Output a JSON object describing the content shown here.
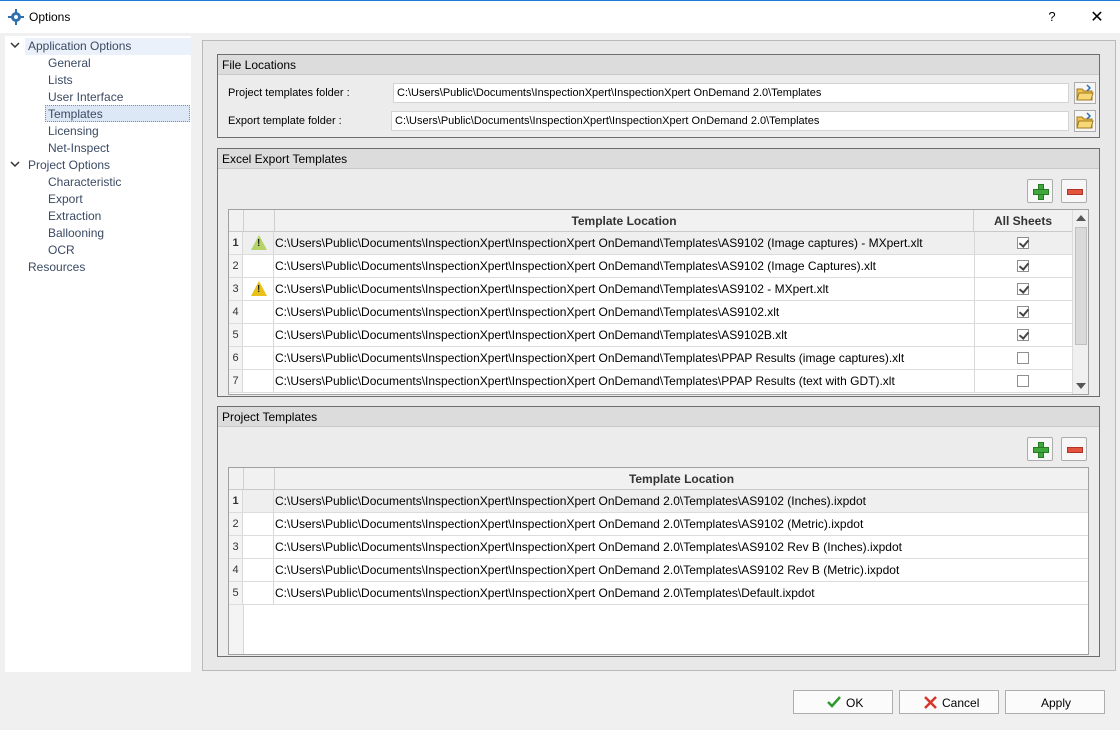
{
  "window": {
    "title": "Options",
    "help_label": "?",
    "close_label": "✕"
  },
  "nav": {
    "application_options": "Application Options",
    "general": "General",
    "lists": "Lists",
    "user_interface": "User Interface",
    "templates": "Templates",
    "licensing": "Licensing",
    "net_inspect": "Net-Inspect",
    "project_options": "Project Options",
    "characteristic": "Characteristic",
    "export": "Export",
    "extraction": "Extraction",
    "ballooning": "Ballooning",
    "ocr": "OCR",
    "resources": "Resources"
  },
  "file_locations": {
    "header": "File Locations",
    "project_label": "Project templates folder :",
    "project_value": "C:\\Users\\Public\\Documents\\InspectionXpert\\InspectionXpert OnDemand 2.0\\Templates",
    "export_label": "Export template folder :",
    "export_value": "C:\\Users\\Public\\Documents\\InspectionXpert\\InspectionXpert OnDemand 2.0\\Templates"
  },
  "excel_templates": {
    "header": "Excel Export Templates",
    "col_location": "Template Location",
    "col_sheets": "All Sheets",
    "rows": [
      {
        "num": "1",
        "location": "C:\\Users\\Public\\Documents\\InspectionXpert\\InspectionXpert OnDemand\\Templates\\AS9102 (Image captures) - MXpert.xlt",
        "all_sheets": true
      },
      {
        "num": "2",
        "location": "C:\\Users\\Public\\Documents\\InspectionXpert\\InspectionXpert OnDemand\\Templates\\AS9102 (Image Captures).xlt",
        "all_sheets": true
      },
      {
        "num": "3",
        "location": "C:\\Users\\Public\\Documents\\InspectionXpert\\InspectionXpert OnDemand\\Templates\\AS9102 - MXpert.xlt",
        "all_sheets": true
      },
      {
        "num": "4",
        "location": "C:\\Users\\Public\\Documents\\InspectionXpert\\InspectionXpert OnDemand\\Templates\\AS9102.xlt",
        "all_sheets": true
      },
      {
        "num": "5",
        "location": "C:\\Users\\Public\\Documents\\InspectionXpert\\InspectionXpert OnDemand\\Templates\\AS9102B.xlt",
        "all_sheets": true
      },
      {
        "num": "6",
        "location": "C:\\Users\\Public\\Documents\\InspectionXpert\\InspectionXpert OnDemand\\Templates\\PPAP Results (image captures).xlt",
        "all_sheets": false
      },
      {
        "num": "7",
        "location": "C:\\Users\\Public\\Documents\\InspectionXpert\\InspectionXpert OnDemand\\Templates\\PPAP Results (text with GDT).xlt",
        "all_sheets": false
      }
    ]
  },
  "project_templates": {
    "header": "Project Templates",
    "col_location": "Template Location",
    "rows": [
      {
        "num": "1",
        "location": "C:\\Users\\Public\\Documents\\InspectionXpert\\InspectionXpert OnDemand 2.0\\Templates\\AS9102 (Inches).ixpdot"
      },
      {
        "num": "2",
        "location": "C:\\Users\\Public\\Documents\\InspectionXpert\\InspectionXpert OnDemand 2.0\\Templates\\AS9102 (Metric).ixpdot"
      },
      {
        "num": "3",
        "location": "C:\\Users\\Public\\Documents\\InspectionXpert\\InspectionXpert OnDemand 2.0\\Templates\\AS9102 Rev B (Inches).ixpdot"
      },
      {
        "num": "4",
        "location": "C:\\Users\\Public\\Documents\\InspectionXpert\\InspectionXpert OnDemand 2.0\\Templates\\AS9102 Rev B (Metric).ixpdot"
      },
      {
        "num": "5",
        "location": "C:\\Users\\Public\\Documents\\InspectionXpert\\InspectionXpert OnDemand 2.0\\Templates\\Default.ixpdot"
      }
    ]
  },
  "buttons": {
    "ok": "OK",
    "cancel": "Cancel",
    "apply": "Apply"
  },
  "icons": {
    "app": "puzzle-gear-icon",
    "folder": "open-folder-icon",
    "add": "plus-icon",
    "remove": "minus-icon",
    "warning": "warning-icon",
    "ok": "checkmark-icon",
    "cancel": "x-icon"
  },
  "colors": {
    "accent": "#1e7ad6",
    "add": "#3fa83c",
    "remove": "#e15540",
    "warning": "#e8c21a",
    "nav_text": "#3b4a63"
  }
}
